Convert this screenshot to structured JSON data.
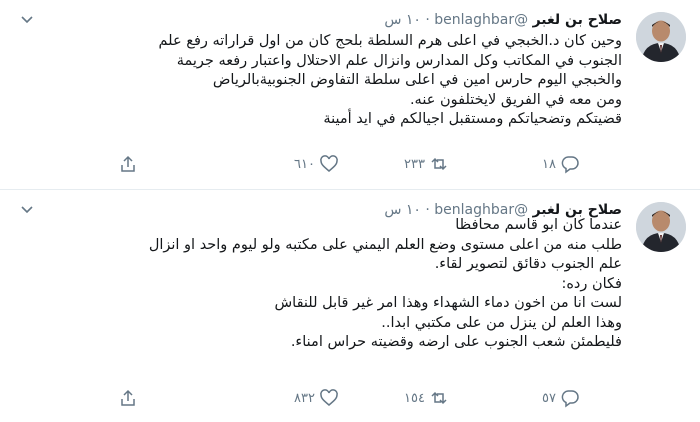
{
  "tweets": [
    {
      "author_name": "صلاح بن لغبر",
      "handle": "@benlaghbar",
      "separator": "·",
      "time": "١٠ س",
      "lines": [
        "وحين كان  د.الخبجي في اعلى هرم السلطة بلحج كان من اول قراراته رفع علم",
        "الجنوب في المكاتب وكل المدارس وانزال علم الاحتلال واعتبار رفعه جريمة",
        "والخبجي اليوم حارس امين في اعلى سلطة التفاوض الجنوبيةبالرياض",
        "ومن معه في الفريق لايختلفون عنه.",
        "قضيتكم وتضحياتكم ومستقبل اجيالكم في ايد أمينة"
      ],
      "reply_count": "١٨",
      "retweet_count": "٢٣٣",
      "like_count": "٦١٠"
    },
    {
      "author_name": "صلاح بن لغبر",
      "handle": "@benlaghbar",
      "separator": "·",
      "time": "١٠ س",
      "lines": [
        "عندما كان ابو قاسم محافظا",
        "طلب منه من اعلى مستوى وضع العلم اليمني على مكتبه ولو ليوم واحد او انزال",
        "علم الجنوب دقائق لتصوير  لقاء.",
        "فكان رده:",
        "لست انا من اخون دماء الشهداء وهذا امر غير قابل للنقاش",
        "وهذا العلم لن ينزل من على مكتبي ابدا..",
        "فليطمئن شعب الجنوب على ارضه وقضيته حراس امناء."
      ],
      "reply_count": "٥٧",
      "retweet_count": "١٥٤",
      "like_count": "٨٣٢"
    }
  ],
  "colors": {
    "text": "#14171a",
    "muted": "#657786",
    "divider": "#e6ecf0"
  },
  "icons": [
    "chevron-down-icon",
    "reply-icon",
    "retweet-icon",
    "like-icon",
    "share-icon"
  ]
}
